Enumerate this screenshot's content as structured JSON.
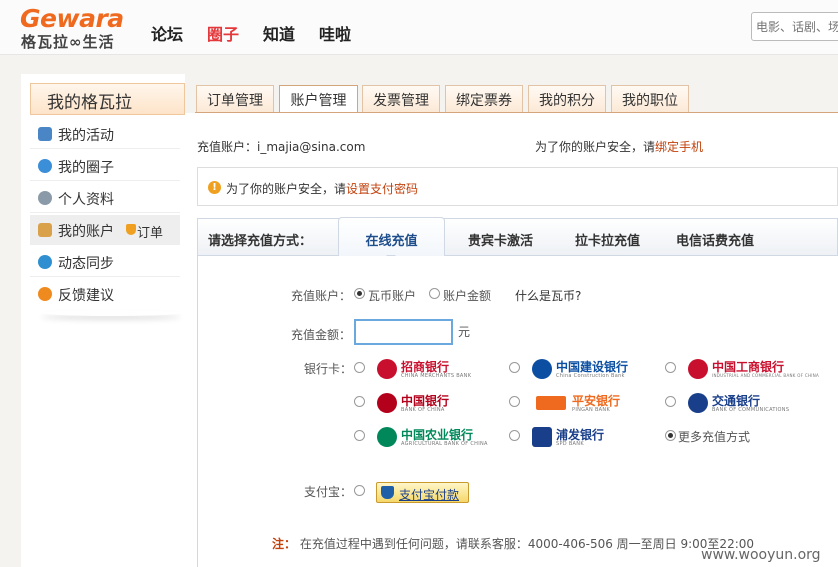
{
  "header": {
    "logo_en": "Gewara",
    "logo_cn": "格瓦拉∞生活",
    "nav": [
      "论坛",
      "圈子",
      "知道",
      "哇啦"
    ],
    "active_nav": "圈子",
    "search_placeholder": "电影、话剧、场"
  },
  "sidebar": {
    "title": "我的格瓦拉",
    "items": [
      {
        "label": "我的活动",
        "icon": "activity-icon"
      },
      {
        "label": "我的圈子",
        "icon": "globe-icon"
      },
      {
        "label": "个人资料",
        "icon": "gear-icon"
      },
      {
        "label": "我的账户",
        "icon": "wallet-icon",
        "sub": "订单"
      },
      {
        "label": "动态同步",
        "icon": "sync-icon"
      },
      {
        "label": "反馈建议",
        "icon": "info-icon"
      }
    ]
  },
  "tabs": [
    "订单管理",
    "账户管理",
    "发票管理",
    "绑定票券",
    "我的积分",
    "我的职位"
  ],
  "active_tab": "账户管理",
  "account": {
    "label": "充值账户：",
    "email": "i_majia@sina.com",
    "security_prefix": "为了你的账户安全，请",
    "security_link": "绑定手机"
  },
  "warning": {
    "prefix": "为了你的账户安全，请",
    "link": "设置支付密码"
  },
  "methods": {
    "label": "请选择充值方式：",
    "tabs": [
      "在线充值",
      "贵宾卡激活",
      "拉卡拉充值",
      "电信话费充值"
    ],
    "active": "在线充值"
  },
  "form": {
    "account_label": "充值账户：",
    "radio_wabi": "瓦币账户",
    "radio_balance": "账户金额",
    "what_is": "什么是瓦币?",
    "amount_label": "充值金额：",
    "amount_value": "",
    "amount_unit": "元",
    "bank_label": "银行卡：",
    "alipay_label": "支付宝：",
    "alipay_button": "支付宝付款",
    "more_methods": "更多充值方式"
  },
  "banks": [
    {
      "name": "招商银行",
      "en": "CHINA MERCHANTS BANK",
      "color": "#c8102e"
    },
    {
      "name": "中国建设银行",
      "en": "China Construction Bank",
      "color": "#0b4ea2"
    },
    {
      "name": "中国工商银行",
      "en": "INDUSTRIAL AND COMMERCIAL BANK OF CHINA",
      "color": "#c8102e"
    },
    {
      "name": "中国银行",
      "en": "BANK OF CHINA",
      "color": "#b3001b"
    },
    {
      "name": "平安银行",
      "en": "PINGAN BANK",
      "color": "#ef6a1f"
    },
    {
      "name": "交通银行",
      "en": "BANK OF COMMUNICATIONS",
      "color": "#1a3f8a"
    },
    {
      "name": "中国农业银行",
      "en": "AGRICULTURAL BANK OF CHINA",
      "color": "#00875a"
    },
    {
      "name": "浦发银行",
      "en": "SPD BANK",
      "color": "#1a3f8a"
    }
  ],
  "note": {
    "label": "注：",
    "text": "在充值过程中遇到任何问题，请联系客服：4000-406-506 周一至周日 9:00至22:00"
  },
  "watermark": "www.wooyun.org"
}
